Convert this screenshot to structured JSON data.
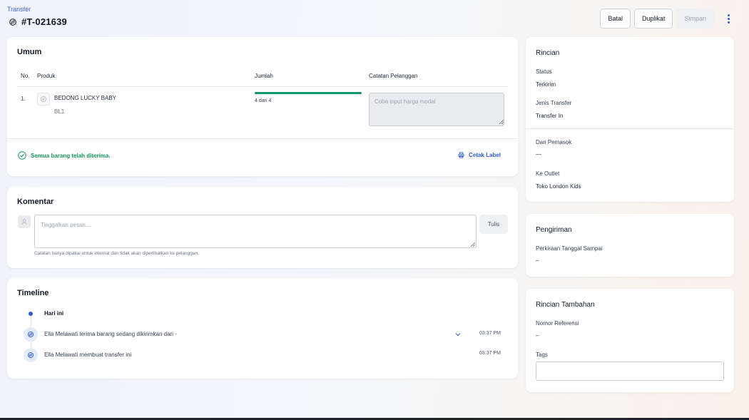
{
  "header": {
    "breadcrumb": "Transfer",
    "title": "#T-021639",
    "actions": {
      "batal": "Batal",
      "duplikat": "Duplikat",
      "simpan": "Simpan"
    }
  },
  "umum": {
    "title": "Umum",
    "columns": {
      "no": "No.",
      "produk": "Produk",
      "jumlah": "Jumlah",
      "catatan": "Catatan Pelanggan"
    },
    "rows": [
      {
        "no": "1.",
        "name": "BEDONG LUCKY BABY",
        "sku": "BL1",
        "qty_text": "4 dari 4",
        "received_fraction": 1.0,
        "note_placeholder": "Coba input harga modal"
      }
    ],
    "status_text": "Semua barang telah diterima.",
    "print_label": "Cetak Label"
  },
  "komentar": {
    "title": "Komentar",
    "placeholder": "Tinggalkan pesan....",
    "submit": "Tulis",
    "hint": "Catatan hanya dipakai untuk internal dan tidak akan diperlihatkan ke pelanggan."
  },
  "timeline": {
    "title": "Timeline",
    "day_label": "Hari ini",
    "events": [
      {
        "text": "Ella Melawati terima barang sedang dikirimkan dari -",
        "time": "03:37 PM"
      },
      {
        "text": "Ella Melawati membuat transfer ini",
        "time": "03:37 PM"
      }
    ]
  },
  "rincian": {
    "title": "Rincian",
    "status_label": "Status",
    "status_value": "Terkirim",
    "jenis_label": "Jenis Transfer",
    "jenis_value": "Transfer In",
    "pemasok_label": "Dari Pemasok",
    "pemasok_value": "—",
    "outlet_label": "Ke Outlet",
    "outlet_value": "Toko London Kids"
  },
  "pengiriman": {
    "title": "Pengiriman",
    "eta_label": "Perkiraan Tanggal Sampai",
    "eta_value": "–"
  },
  "tambahan": {
    "title": "Rincian Tambahan",
    "ref_label": "Nomor Referensi",
    "ref_value": "–",
    "tags_label": "Tags"
  },
  "colors": {
    "accent": "#2f5bd3",
    "success": "#129a6b"
  }
}
